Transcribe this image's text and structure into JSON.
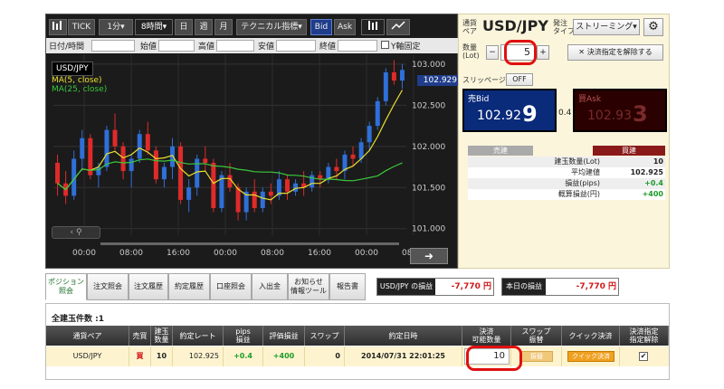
{
  "toolbar": {
    "items": [
      "TICK",
      "1分",
      "8時間",
      "日",
      "週",
      "月",
      "テクニカル指標",
      "Bid",
      "Ask"
    ],
    "ohlc_labels": [
      "日付/時間",
      "始値",
      "高値",
      "安値",
      "終値"
    ],
    "yaxis_fix_label": "Y軸固定"
  },
  "chart": {
    "pair_label": "USD/JPY",
    "ma_labels": [
      "MA(5, close)",
      "MA(25, close)"
    ],
    "current_price": "102.929"
  },
  "chart_data": {
    "type": "candlestick",
    "x_ticks": [
      "00:00",
      "08:00",
      "16:00",
      "00:00",
      "08:00",
      "16:00",
      "00:00",
      "08:00"
    ],
    "y_ticks": [
      "103.000",
      "102.500",
      "102.000",
      "101.500",
      "101.000"
    ],
    "ylim": [
      100.92,
      103.12
    ],
    "candles": [
      [
        101.8,
        101.9,
        101.4,
        101.55
      ],
      [
        101.55,
        101.7,
        101.3,
        101.4
      ],
      [
        101.4,
        101.95,
        101.35,
        101.85
      ],
      [
        101.85,
        102.2,
        101.7,
        102.1
      ],
      [
        102.1,
        102.15,
        101.6,
        101.65
      ],
      [
        101.65,
        101.8,
        101.5,
        101.75
      ],
      [
        101.75,
        102.25,
        101.7,
        102.2
      ],
      [
        102.2,
        102.4,
        101.95,
        102.0
      ],
      [
        102.0,
        102.05,
        101.6,
        101.7
      ],
      [
        101.7,
        101.9,
        101.5,
        101.85
      ],
      [
        101.85,
        102.2,
        101.8,
        102.15
      ],
      [
        102.15,
        102.3,
        101.9,
        101.95
      ],
      [
        101.95,
        102.0,
        101.55,
        101.6
      ],
      [
        101.6,
        101.8,
        101.5,
        101.75
      ],
      [
        101.75,
        102.1,
        101.6,
        102.0
      ],
      [
        102.0,
        102.05,
        101.3,
        101.35
      ],
      [
        101.35,
        101.6,
        101.2,
        101.5
      ],
      [
        101.5,
        101.9,
        101.4,
        101.85
      ],
      [
        101.85,
        102.0,
        101.7,
        101.8
      ],
      [
        101.8,
        101.85,
        101.2,
        101.25
      ],
      [
        101.25,
        101.7,
        101.2,
        101.65
      ],
      [
        101.65,
        101.8,
        101.45,
        101.5
      ],
      [
        101.5,
        101.55,
        101.1,
        101.2
      ],
      [
        101.2,
        101.5,
        101.1,
        101.45
      ],
      [
        101.45,
        101.6,
        101.2,
        101.25
      ],
      [
        101.25,
        101.5,
        101.2,
        101.45
      ],
      [
        101.45,
        101.55,
        101.3,
        101.4
      ],
      [
        101.4,
        101.7,
        101.35,
        101.6
      ],
      [
        101.6,
        101.65,
        101.35,
        101.45
      ],
      [
        101.45,
        101.6,
        101.4,
        101.55
      ],
      [
        101.55,
        101.7,
        101.4,
        101.5
      ],
      [
        101.5,
        101.7,
        101.45,
        101.65
      ],
      [
        101.65,
        101.7,
        101.5,
        101.6
      ],
      [
        101.6,
        101.8,
        101.55,
        101.75
      ],
      [
        101.75,
        101.85,
        101.6,
        101.7
      ],
      [
        101.7,
        101.95,
        101.6,
        101.9
      ],
      [
        101.9,
        102.0,
        101.75,
        101.85
      ],
      [
        101.85,
        102.1,
        101.8,
        102.05
      ],
      [
        102.05,
        102.3,
        101.95,
        102.25
      ],
      [
        102.25,
        102.6,
        102.2,
        102.55
      ],
      [
        102.55,
        102.95,
        102.5,
        102.9
      ],
      [
        102.9,
        103.05,
        102.75,
        102.8
      ],
      [
        102.8,
        103.0,
        102.7,
        102.93
      ]
    ],
    "ma5_color": "#e8e030",
    "ma25_color": "#3cc63c",
    "up_color": "#2f6fd8",
    "down_color": "#e02a2a"
  },
  "order": {
    "pair_caption": "通貨\nペア",
    "pair": "USD/JPY",
    "type_caption": "発注\nタイプ",
    "type_value": "ストリーミング",
    "qty_caption": "数量\n(Lot)",
    "qty_value": "5",
    "settle_button": "決済指定を解除する",
    "slippage_label": "スリッページ",
    "slippage_value": "OFF",
    "bid_label": "売Bid",
    "bid_big": "102.92",
    "bid_small": "9",
    "spread": "0.4",
    "ask_label": "買Ask",
    "ask_big": "102.93",
    "ask_small": "3",
    "sell_header": "売建",
    "buy_header": "買建",
    "rows": [
      {
        "label": "建玉数量(Lot)",
        "value": "10"
      },
      {
        "label": "平均建値",
        "value": "102.925"
      },
      {
        "label": "損益(pips)",
        "value": "+0.4"
      },
      {
        "label": "概算損益(円)",
        "value": "+400"
      }
    ]
  },
  "tabs": [
    "ポジション\n照会",
    "注文照会",
    "注文履歴",
    "約定履歴",
    "口座照会",
    "入出金",
    "お知らせ\n情報ツール",
    "報告書"
  ],
  "pl": {
    "pair_pl_label": "USD/JPY の損益",
    "pair_pl_value": "-7,770 円",
    "today_pl_label": "本日の損益",
    "today_pl_value": "-7,770 円"
  },
  "positions": {
    "count_label": "全建玉件数 :1",
    "columns": [
      "通貨ペア",
      "売買",
      "建玉\n数量",
      "約定レート",
      "pips\n損益",
      "評価損益",
      "スワップ",
      "約定日時",
      "決済\n可能数量",
      "スワップ\n振替",
      "クイック決済",
      "決済指定\n指定解除"
    ],
    "row": {
      "pair": "USD/JPY",
      "side": "買",
      "qty": "10",
      "rate": "102.925",
      "pips": "+0.4",
      "pl": "+400",
      "swap": "0",
      "datetime": "2014/07/31 22:01:25",
      "settle_qty": "10",
      "swap_transfer": "振替",
      "quick_settle": "クイック決済",
      "checked": "✔"
    }
  }
}
